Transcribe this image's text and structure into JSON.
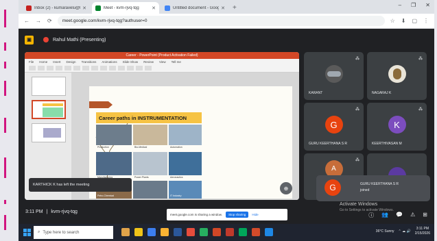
{
  "browser": {
    "tabs": [
      {
        "label": "Inbox (2) - kumaravelu@btech...",
        "active": false,
        "favicon_color": "#c5221f"
      },
      {
        "label": "Meet - kvm-rjvq-tqg",
        "active": true,
        "favicon_color": "#00832d"
      },
      {
        "label": "Untitled document - Google D...",
        "active": false,
        "favicon_color": "#4285f4"
      }
    ],
    "new_tab": "+",
    "window_controls": [
      "–",
      "❐",
      "✕"
    ],
    "address": "meet.google.com/kvm-rjvq-tqg?authuser=0",
    "nav_icons": [
      "←",
      "→",
      "⟳"
    ],
    "toolbar_icons": [
      "☆",
      "⬇",
      "▢",
      "⋮"
    ]
  },
  "meet": {
    "presenting_label": "Rahul Mathi (Presenting)",
    "logo_glyph": "▣",
    "left_meeting_message": "KARTHICK K has left the meeting",
    "time": "3:11 PM",
    "meeting_code": "kvm-rjvq-tqg",
    "share_banner": {
      "text": "meet.google.com is sharing a window.",
      "stop_label": "Stop sharing",
      "hide_label": "Hide"
    },
    "activate_title": "Activate Windows",
    "activate_sub": "Go to Settings to activate Windows.",
    "controls": [
      "ⓘ",
      "👥",
      "💬",
      "⚠",
      "⊞"
    ]
  },
  "slide": {
    "app_title": "Career - PowerPoint (Product Activation Failed)",
    "ribbon_tabs": [
      "File",
      "Home",
      "Insert",
      "Design",
      "Transitions",
      "Animations",
      "Slide Show",
      "Review",
      "View",
      "Tell me"
    ],
    "heading": "Career paths in INSTRUMENTATION",
    "captions": [
      "Production",
      "Bio-Medical",
      "Automation",
      "Manufacturing",
      "Power Plants",
      "Aeronautics",
      "Petro-Chemical",
      "IT Industry"
    ]
  },
  "participants": [
    {
      "name": "KARANT",
      "initial": "",
      "color": "#5a5a5a",
      "photo": true
    },
    {
      "name": "NAGARAJ K",
      "initial": "",
      "color": "#c9c9c9",
      "photo": true
    },
    {
      "name": "GURU KEERTHANA S R",
      "initial": "G",
      "color": "#e8430f"
    },
    {
      "name": "KEERTHIVASAN M",
      "initial": "K",
      "color": "#7c4dbe"
    },
    {
      "name": "",
      "initial": "A",
      "color": "#c76d3a"
    },
    {
      "name": "",
      "initial": "",
      "color": "#5b3aa1"
    }
  ],
  "self_tile": {
    "name": "GURU KEERTHANA S R",
    "sub": "joined",
    "initial": "G",
    "color": "#e8430f"
  },
  "taskbar": {
    "search_placeholder": "Type here to search",
    "weather": "36°C Sunny",
    "time": "3:11 PM",
    "date": "2/15/2026"
  }
}
